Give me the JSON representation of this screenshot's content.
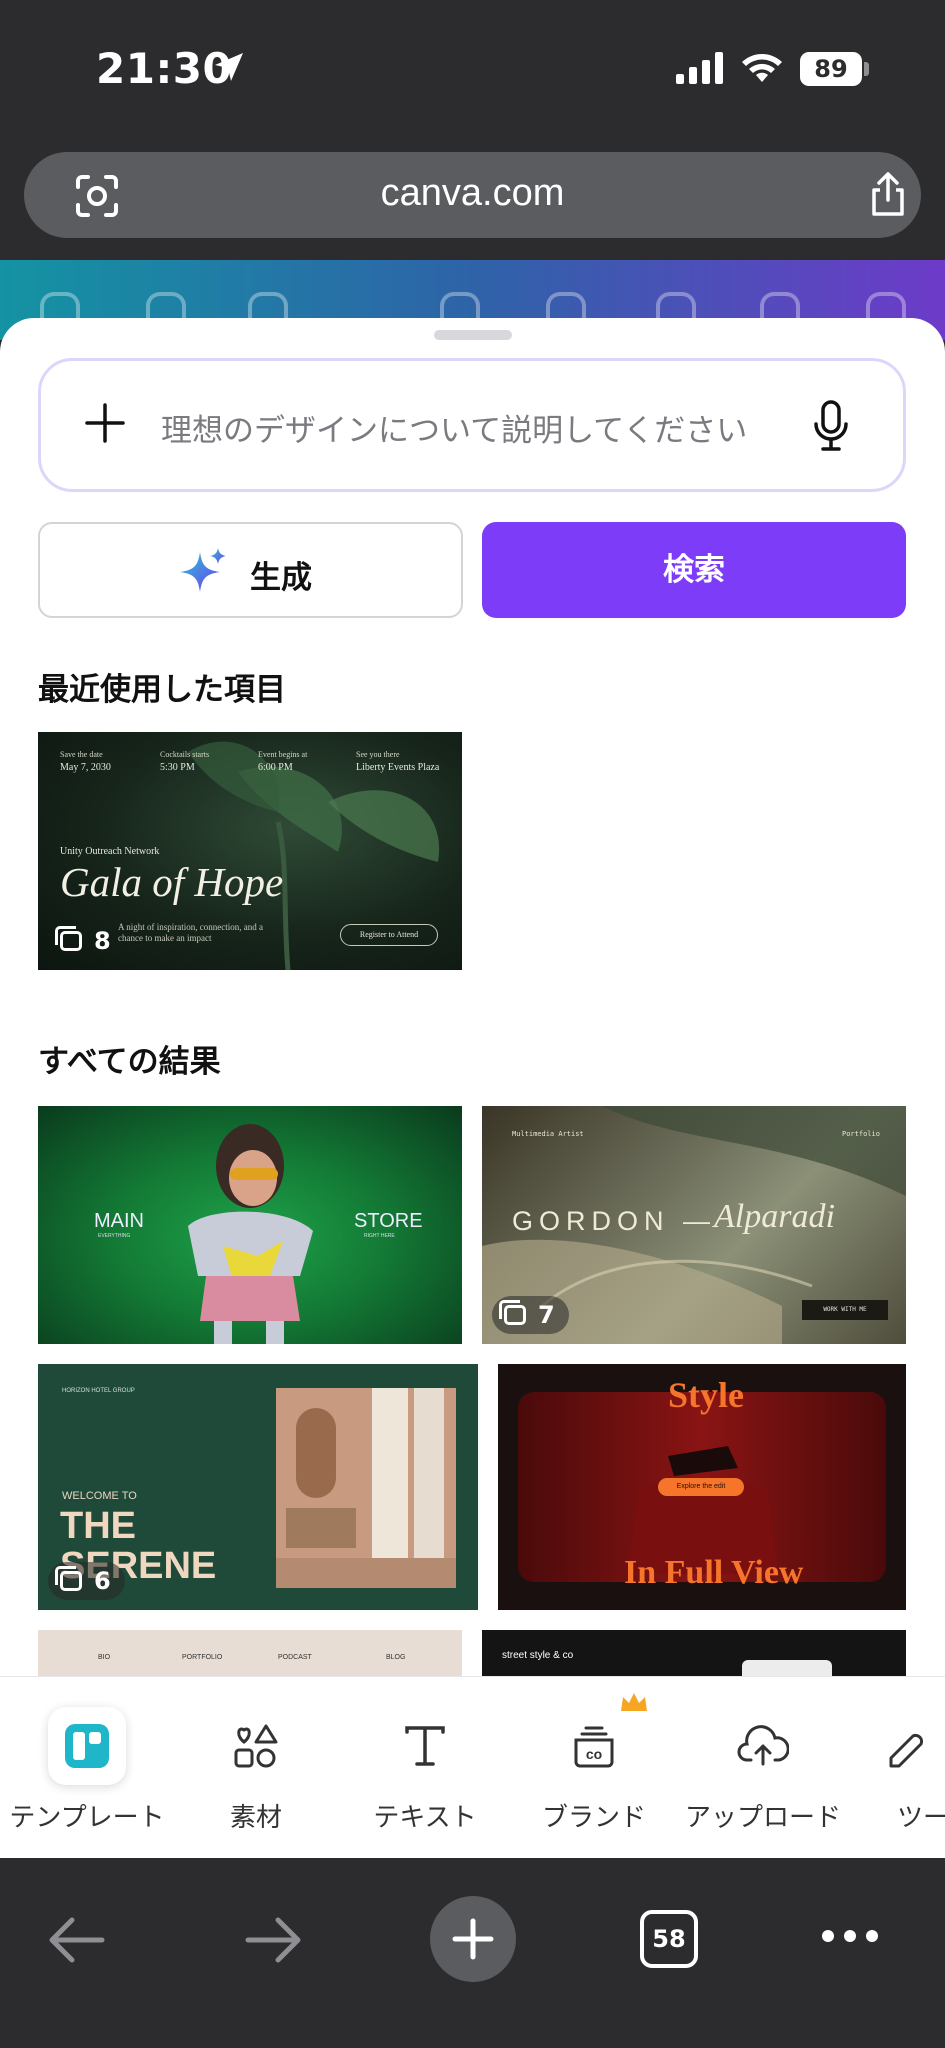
{
  "status_bar": {
    "time": "21:30",
    "battery": "89"
  },
  "browser": {
    "url": "canva.com",
    "tab_count": "58"
  },
  "search": {
    "placeholder": "理想のデザインについて説明してください",
    "generate_label": "生成",
    "search_label": "検索"
  },
  "recent": {
    "title": "最近使用した項目",
    "items": [
      {
        "name": "Gala of Hope",
        "pages": "8",
        "org": "Unity Outreach Network",
        "dates": [
          {
            "label": "Save the date",
            "value": "May 7, 2030"
          },
          {
            "label": "Cocktails starts",
            "value": "5:30 PM"
          },
          {
            "label": "Event begins at",
            "value": "6:00 PM"
          },
          {
            "label": "See you there",
            "value": "Liberty Events Plaza"
          }
        ],
        "tagline": "A night of inspiration, connection, and a chance to make an impact",
        "cta": "Register to Attend"
      }
    ]
  },
  "results": {
    "title": "すべての結果",
    "items": [
      {
        "left_text": "MAIN",
        "left_sub": "EVERYTHING",
        "right_text": "STORE",
        "right_sub": "RIGHT HERE"
      },
      {
        "tag_left": "Multimedia Artist",
        "tag_right": "Portfolio",
        "headline": "GORDON —",
        "script": "Alparadi",
        "cta": "WORK WITH ME",
        "pages": "7"
      },
      {
        "brand": "HORIZON HOTEL GROUP",
        "welcome": "WELCOME TO",
        "headline_1": "THE",
        "headline_2": "SERENE",
        "pages": "6"
      },
      {
        "title": "Style",
        "cta": "Explore the edit",
        "subtitle": "In Full View"
      },
      {
        "nav": [
          "BIO",
          "PORTFOLIO",
          "PODCAST",
          "BLOG"
        ]
      },
      {
        "tag": "street style & co"
      }
    ]
  },
  "tool_tabs": [
    {
      "label": "テンプレート",
      "icon": "template-icon",
      "active": true
    },
    {
      "label": "素材",
      "icon": "elements-icon"
    },
    {
      "label": "テキスト",
      "icon": "text-icon"
    },
    {
      "label": "ブランド",
      "icon": "brand-icon",
      "premium": true
    },
    {
      "label": "アップロード",
      "icon": "upload-icon"
    },
    {
      "label": "ツー",
      "icon": "tools-icon"
    }
  ],
  "colors": {
    "accent": "#7d3cf8",
    "brand_teal": "#1fb6c9"
  }
}
